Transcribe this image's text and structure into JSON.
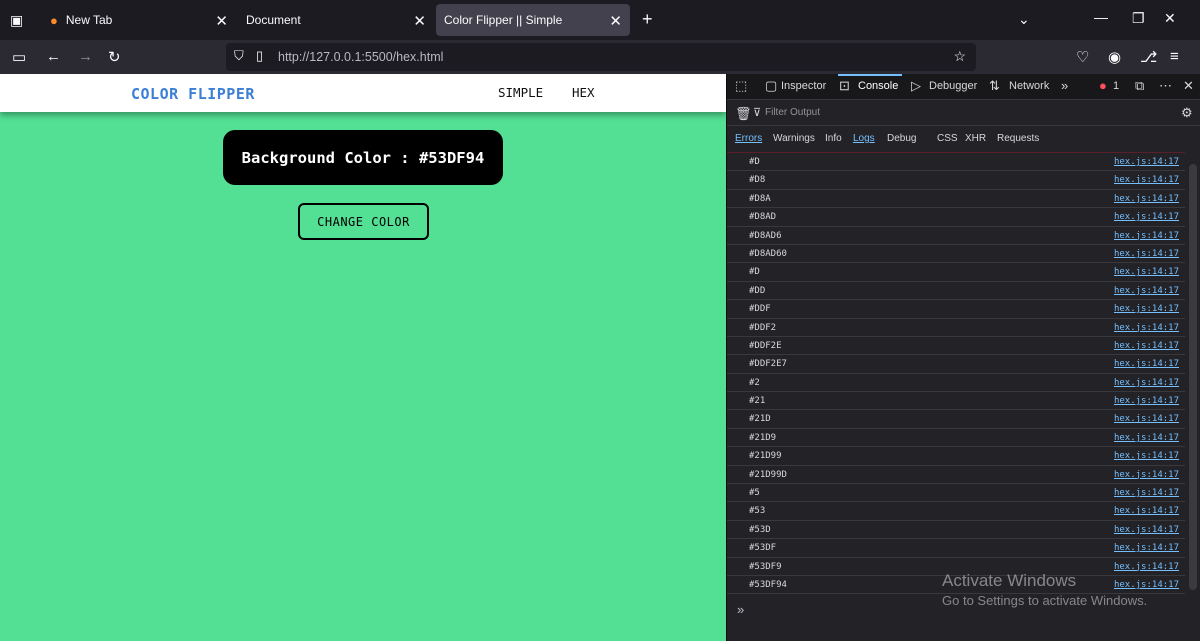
{
  "browser": {
    "tabs": [
      {
        "title": "New Tab"
      },
      {
        "title": "Document"
      },
      {
        "title": "Color Flipper || Simple"
      }
    ],
    "url": "http://127.0.0.1:5500/hex.html"
  },
  "page": {
    "brand": "COLOR FLIPPER",
    "nav": [
      "SIMPLE",
      "HEX"
    ],
    "bg_label": "Background Color : #53DF94",
    "button": "CHANGE COLOR",
    "background": "#53df94"
  },
  "devtools": {
    "tabs": [
      "Inspector",
      "Console",
      "Debugger",
      "Network"
    ],
    "error_count": "1",
    "filter_placeholder": "Filter Output",
    "categories": [
      "Errors",
      "Warnings",
      "Info",
      "Logs",
      "Debug",
      "CSS",
      "XHR",
      "Requests"
    ],
    "logs": [
      {
        "msg": "#D",
        "src": "hex.js:14:17"
      },
      {
        "msg": "#D8",
        "src": "hex.js:14:17"
      },
      {
        "msg": "#D8A",
        "src": "hex.js:14:17"
      },
      {
        "msg": "#D8AD",
        "src": "hex.js:14:17"
      },
      {
        "msg": "#D8AD6",
        "src": "hex.js:14:17"
      },
      {
        "msg": "#D8AD60",
        "src": "hex.js:14:17"
      },
      {
        "msg": "#D",
        "src": "hex.js:14:17"
      },
      {
        "msg": "#DD",
        "src": "hex.js:14:17"
      },
      {
        "msg": "#DDF",
        "src": "hex.js:14:17"
      },
      {
        "msg": "#DDF2",
        "src": "hex.js:14:17"
      },
      {
        "msg": "#DDF2E",
        "src": "hex.js:14:17"
      },
      {
        "msg": "#DDF2E7",
        "src": "hex.js:14:17"
      },
      {
        "msg": "#2",
        "src": "hex.js:14:17"
      },
      {
        "msg": "#21",
        "src": "hex.js:14:17"
      },
      {
        "msg": "#21D",
        "src": "hex.js:14:17"
      },
      {
        "msg": "#21D9",
        "src": "hex.js:14:17"
      },
      {
        "msg": "#21D99",
        "src": "hex.js:14:17"
      },
      {
        "msg": "#21D99D",
        "src": "hex.js:14:17"
      },
      {
        "msg": "#5",
        "src": "hex.js:14:17"
      },
      {
        "msg": "#53",
        "src": "hex.js:14:17"
      },
      {
        "msg": "#53D",
        "src": "hex.js:14:17"
      },
      {
        "msg": "#53DF",
        "src": "hex.js:14:17"
      },
      {
        "msg": "#53DF9",
        "src": "hex.js:14:17"
      },
      {
        "msg": "#53DF94",
        "src": "hex.js:14:17"
      }
    ]
  },
  "watermark": {
    "line1": "Activate Windows",
    "line2": "Go to Settings to activate Windows."
  }
}
